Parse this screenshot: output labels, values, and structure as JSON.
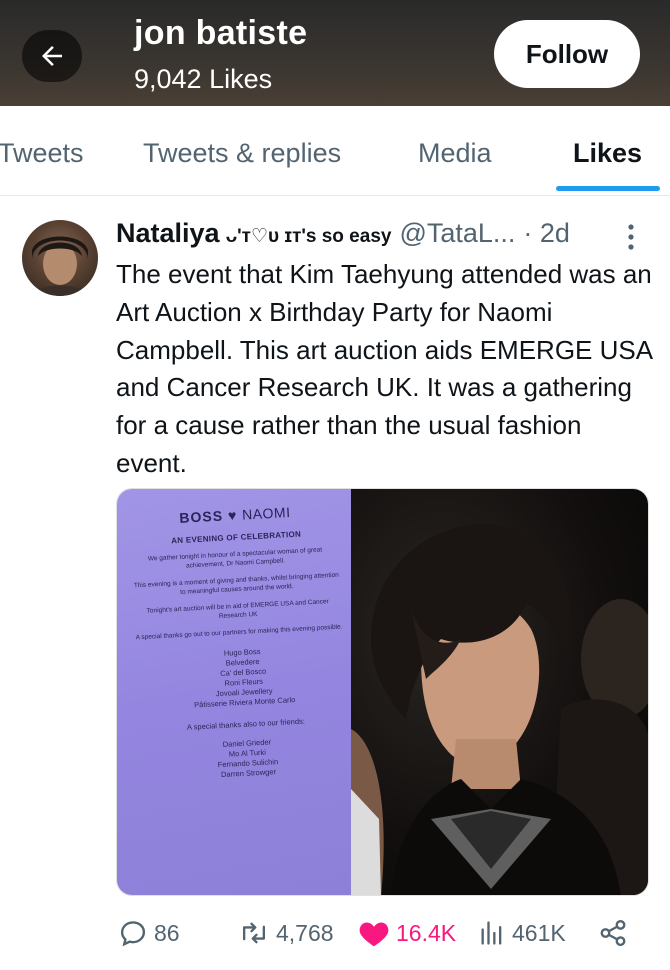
{
  "header": {
    "profile_name": "jon batiste",
    "likes_count": "9,042 Likes",
    "follow_label": "Follow"
  },
  "tabs": [
    {
      "label": "Tweets",
      "active": false
    },
    {
      "label": "Tweets & replies",
      "active": false
    },
    {
      "label": "Media",
      "active": false
    },
    {
      "label": "Likes",
      "active": true
    }
  ],
  "tweet": {
    "author_name": "Nataliya",
    "author_decoration": "ᴗ'ᴛ♡ᴜ ɪᴛ's so easy",
    "author_handle": "@TataL...",
    "time": "· 2d",
    "text": "The event that Kim Taehyung attended was an Art Auction x Birthday Party for Naomi Campbell. This art auction aids EMERGE USA and Cancer Research UK. It was a gathering for a cause rather than the usual fashion event.",
    "media": {
      "card_brand_left": "BOSS",
      "card_brand_right": "NAOMI",
      "card_subtitle": "AN EVENING OF CELEBRATION",
      "card_p1": "We gather tonight in honour of a spectacular woman of great achievement, Dr Naomi Campbell.",
      "card_p2": "This evening is a moment of giving and thanks, whilst bringing attention to meaningful causes around the world.",
      "card_p3": "Tonight's art auction will be in aid of EMERGE USA and Cancer Research UK",
      "card_p4": "A special thanks go out to our partners for making this evening possible.",
      "card_partners": [
        "Hugo Boss",
        "Belvedere",
        "Ca' del Bosco",
        "Roni Fleurs",
        "Jovoali Jewellery",
        "Pâtisserie Riviera Monte Carlo"
      ],
      "card_friends_heading": "A special thanks also to our friends:",
      "card_friends": [
        "Daniel Grieder",
        "Mo Al Turki",
        "Fernando Sulichin",
        "Darren Strowger"
      ]
    },
    "actions": {
      "replies": "86",
      "retweets": "4,768",
      "likes": "16.4K",
      "views": "461K"
    }
  },
  "colors": {
    "accent": "#1d9bf0",
    "like": "#f91880",
    "muted": "#536471"
  }
}
